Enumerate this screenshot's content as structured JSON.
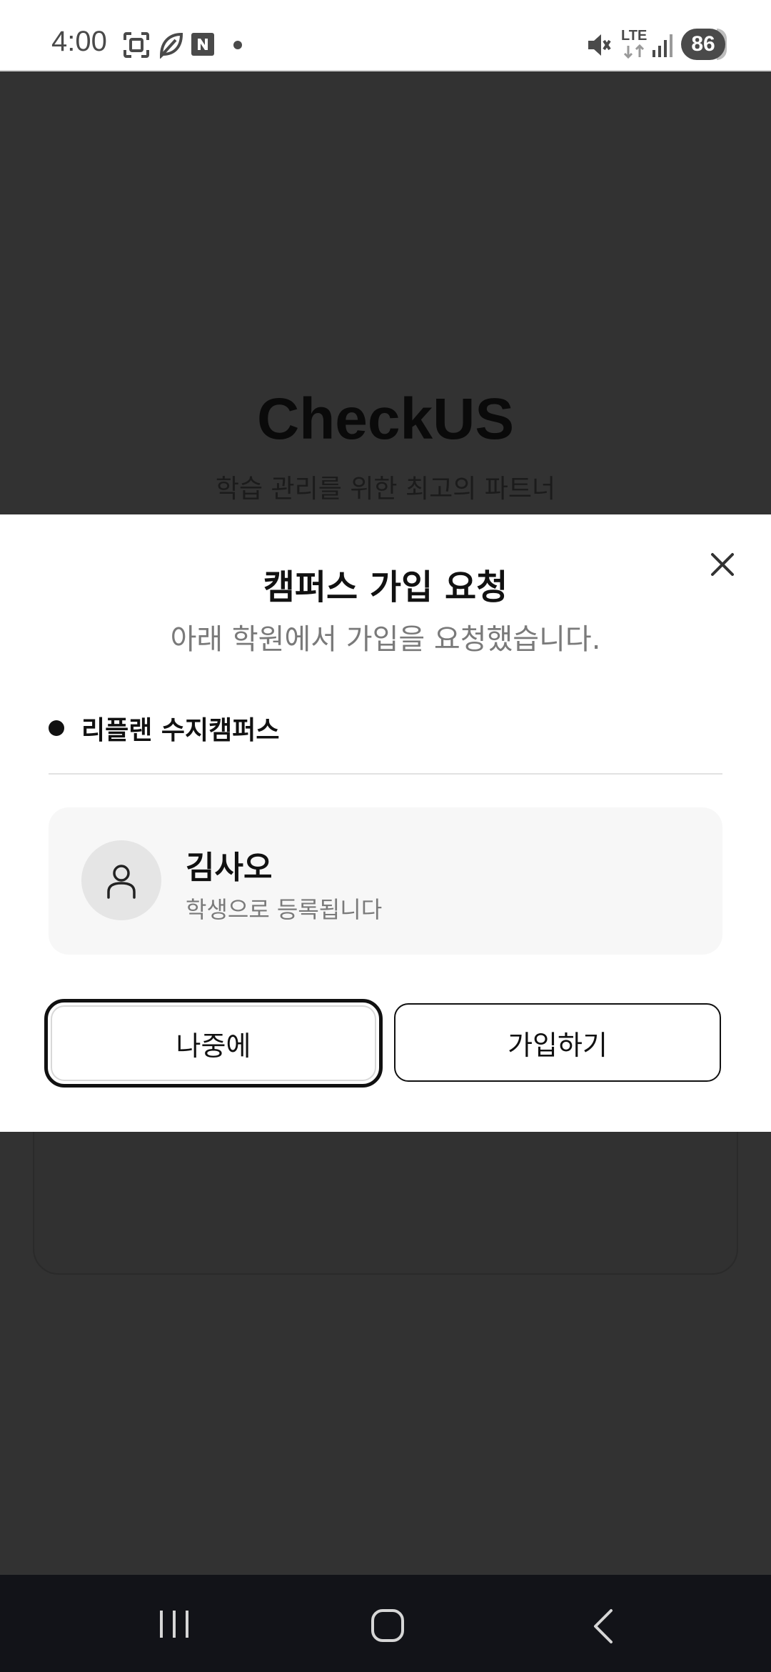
{
  "status_bar": {
    "time": "4:00",
    "battery": "86",
    "network": "LTE",
    "icons": [
      "screenshot-icon",
      "leaf-icon",
      "naver-icon",
      "dot-icon",
      "mute-icon",
      "lte-icon",
      "signal-icon",
      "battery-icon"
    ]
  },
  "background": {
    "app_title": "CheckUS",
    "app_subtitle": "학습 관리를 위한 최고의 파트너"
  },
  "modal": {
    "title": "캠퍼스 가입 요청",
    "subtitle": "아래 학원에서 가입을 요청했습니다.",
    "campus_name": "리플랜 수지캠퍼스",
    "user": {
      "name": "김사오",
      "role": "학생으로 등록됩니다"
    },
    "later_label": "나중에",
    "join_label": "가입하기"
  },
  "nav": {
    "icons": [
      "recent-apps-icon",
      "home-icon",
      "back-icon"
    ]
  }
}
